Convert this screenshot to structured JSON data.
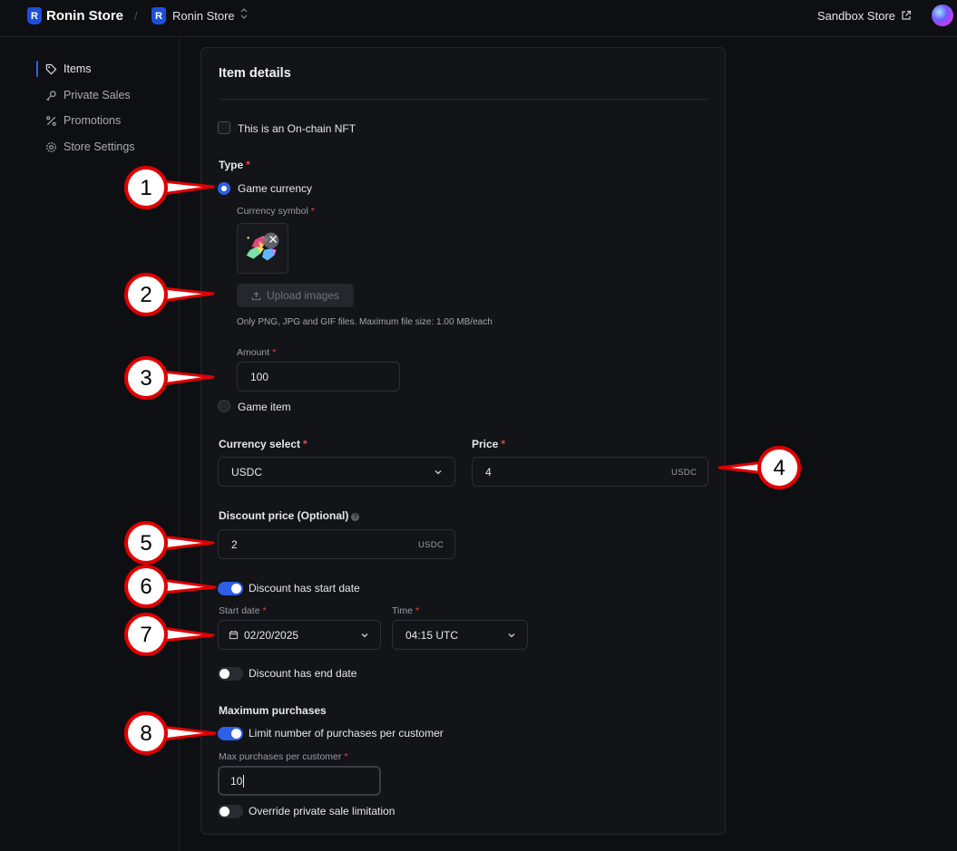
{
  "header": {
    "brand_title": "Ronin Store",
    "crumb_separator": "/",
    "store_name": "Ronin Store",
    "sandbox_link": "Sandbox Store"
  },
  "sidebar": {
    "items": [
      {
        "label": "Items",
        "icon": "tag-icon",
        "active": true
      },
      {
        "label": "Private Sales",
        "icon": "key-icon",
        "active": false
      },
      {
        "label": "Promotions",
        "icon": "percent-icon",
        "active": false
      },
      {
        "label": "Store Settings",
        "icon": "gear-icon",
        "active": false
      }
    ]
  },
  "form": {
    "title": "Item details",
    "onchain_label": "This is an On-chain NFT",
    "onchain_checked": false,
    "type_label": "Type",
    "type_options": [
      {
        "label": "Game currency",
        "selected": true
      },
      {
        "label": "Game item",
        "selected": false
      }
    ],
    "currency_symbol_label": "Currency symbol",
    "upload_button": "Upload images",
    "upload_hint": "Only PNG, JPG and GIF files. Maximum file size: 1.00 MB/each",
    "amount_label": "Amount",
    "amount_value": "100",
    "currency_select_label": "Currency select",
    "currency_select_value": "USDC",
    "price_label": "Price",
    "price_value": "4",
    "price_unit": "USDC",
    "discount_label": "Discount price (Optional)",
    "discount_value": "2",
    "discount_unit": "USDC",
    "discount_start_toggle": "Discount has start date",
    "discount_start_on": true,
    "start_date_label": "Start date",
    "start_date_value": "02/20/2025",
    "time_label": "Time",
    "time_value": "04:15 UTC",
    "discount_end_toggle": "Discount has end date",
    "discount_end_on": false,
    "max_purchases_heading": "Maximum purchases",
    "limit_toggle": "Limit number of purchases per customer",
    "limit_on": true,
    "max_per_customer_label": "Max purchases per customer",
    "max_per_customer_value": "10",
    "override_toggle": "Override private sale limitation",
    "override_on": false,
    "required_mark": "*"
  },
  "annotations": [
    "1",
    "2",
    "3",
    "4",
    "5",
    "6",
    "7",
    "8"
  ],
  "colors": {
    "accent": "#2f5fe6",
    "required": "#e84545",
    "callout_fill": "#ffffff",
    "callout_stroke": "#e00000"
  }
}
